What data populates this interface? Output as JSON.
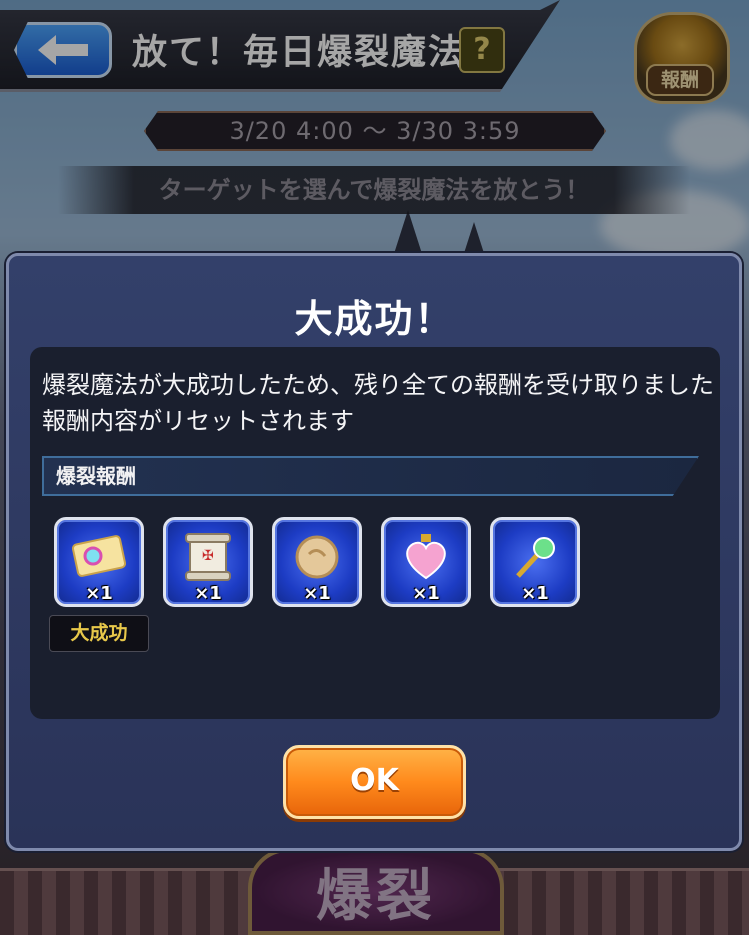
{
  "header": {
    "title": "放て！毎日爆裂魔法",
    "help_symbol": "?",
    "reward_label": "報酬"
  },
  "event": {
    "period": "3/20 4:00 ～ 3/30 3:59",
    "instruction": "ターゲットを選んで爆裂魔法を放とう！"
  },
  "background": {
    "emblem_text": "爆裂"
  },
  "modal": {
    "title": "大成功！",
    "message_line1": "爆裂魔法が大成功したため、残り全ての報酬を受け取りました",
    "message_line2": "報酬内容がリセットされます",
    "section_label": "爆裂報酬",
    "rewards": [
      {
        "icon": "ticket-icon",
        "qty": "×1"
      },
      {
        "icon": "scroll-icon",
        "qty": "×1"
      },
      {
        "icon": "cookie-icon",
        "qty": "×1"
      },
      {
        "icon": "heart-potion-icon",
        "qty": "×1"
      },
      {
        "icon": "magic-wand-icon",
        "qty": "×1"
      }
    ],
    "success_badge": "大成功",
    "ok_label": "OK"
  },
  "colors": {
    "modal_bg": "#2a3358",
    "ok_button": "#ff8a1c",
    "back_button": "#1c5fd6",
    "badge_text": "#e8c84a"
  }
}
